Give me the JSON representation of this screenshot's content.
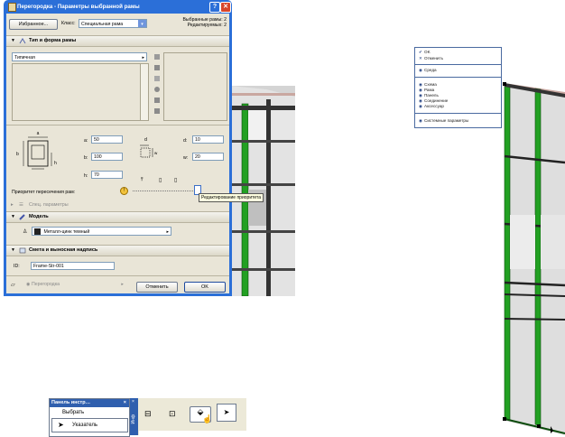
{
  "dialog": {
    "title": "Перегородка - Параметры выбранной рамы",
    "favorites_button": "Избранное...",
    "class_label": "Класс:",
    "class_value": "Специальная рама",
    "selected_info_1": "Выбранные рамы: 2",
    "selected_info_2": "Редактируемых: 2",
    "help_glyph": "?",
    "close_glyph": "✕"
  },
  "section_type": {
    "title": "Тип и форма рамы",
    "type_value": "Типичная"
  },
  "dimensions": {
    "a_label": "a:",
    "a_value": "50",
    "b_label": "b:",
    "b_value": "100",
    "h_label": "h:",
    "h_value": "70",
    "d_label": "d",
    "d_field_label": "d:",
    "d_value": "10",
    "w_label": "w:",
    "w_value": "20",
    "diag_a": "a",
    "diag_b": "b",
    "diag_h": "h",
    "diag_w": "w"
  },
  "priority": {
    "label": "Приоритет пересечения рам:",
    "tooltip": "Редактирование приоритета",
    "value": 1.0
  },
  "special_params": {
    "title": "Спец. параметры"
  },
  "section_model": {
    "title": "Модель",
    "material": "Металл-цинк темный"
  },
  "section_listing": {
    "title": "Смета и выносная надпись",
    "id_label": "ID:",
    "id_value": "Frame-Str-001"
  },
  "footer": {
    "layer": "Перегородка",
    "cancel": "Отменить",
    "ok": "OK"
  },
  "context_menu": {
    "items": [
      {
        "glyph": "✔",
        "label": "OK"
      },
      {
        "glyph": "✕",
        "label": "Отменить"
      },
      {
        "glyph": "◉",
        "label": "Среда"
      },
      {
        "glyph": "◉",
        "label": "Схема"
      },
      {
        "glyph": "◉",
        "label": "Рама"
      },
      {
        "glyph": "◉",
        "label": "Панель"
      },
      {
        "glyph": "◉",
        "label": "Соединение"
      },
      {
        "glyph": "◉",
        "label": "Аксессуар"
      },
      {
        "glyph": "◉",
        "label": "Системные параметры"
      }
    ]
  },
  "toolbox": {
    "title": "Панель инстр…",
    "close_glyph": "×",
    "select_label": "Выбрать",
    "pointer_label": "Указатель"
  },
  "infobox": {
    "close_glyph": "×",
    "tab_label": "Инф"
  },
  "colors": {
    "titlebar": "#2b6fd8",
    "dialog_bg": "#e9e5d7",
    "frame_green": "#22a022",
    "tooltip_bg": "#ffffe1"
  }
}
